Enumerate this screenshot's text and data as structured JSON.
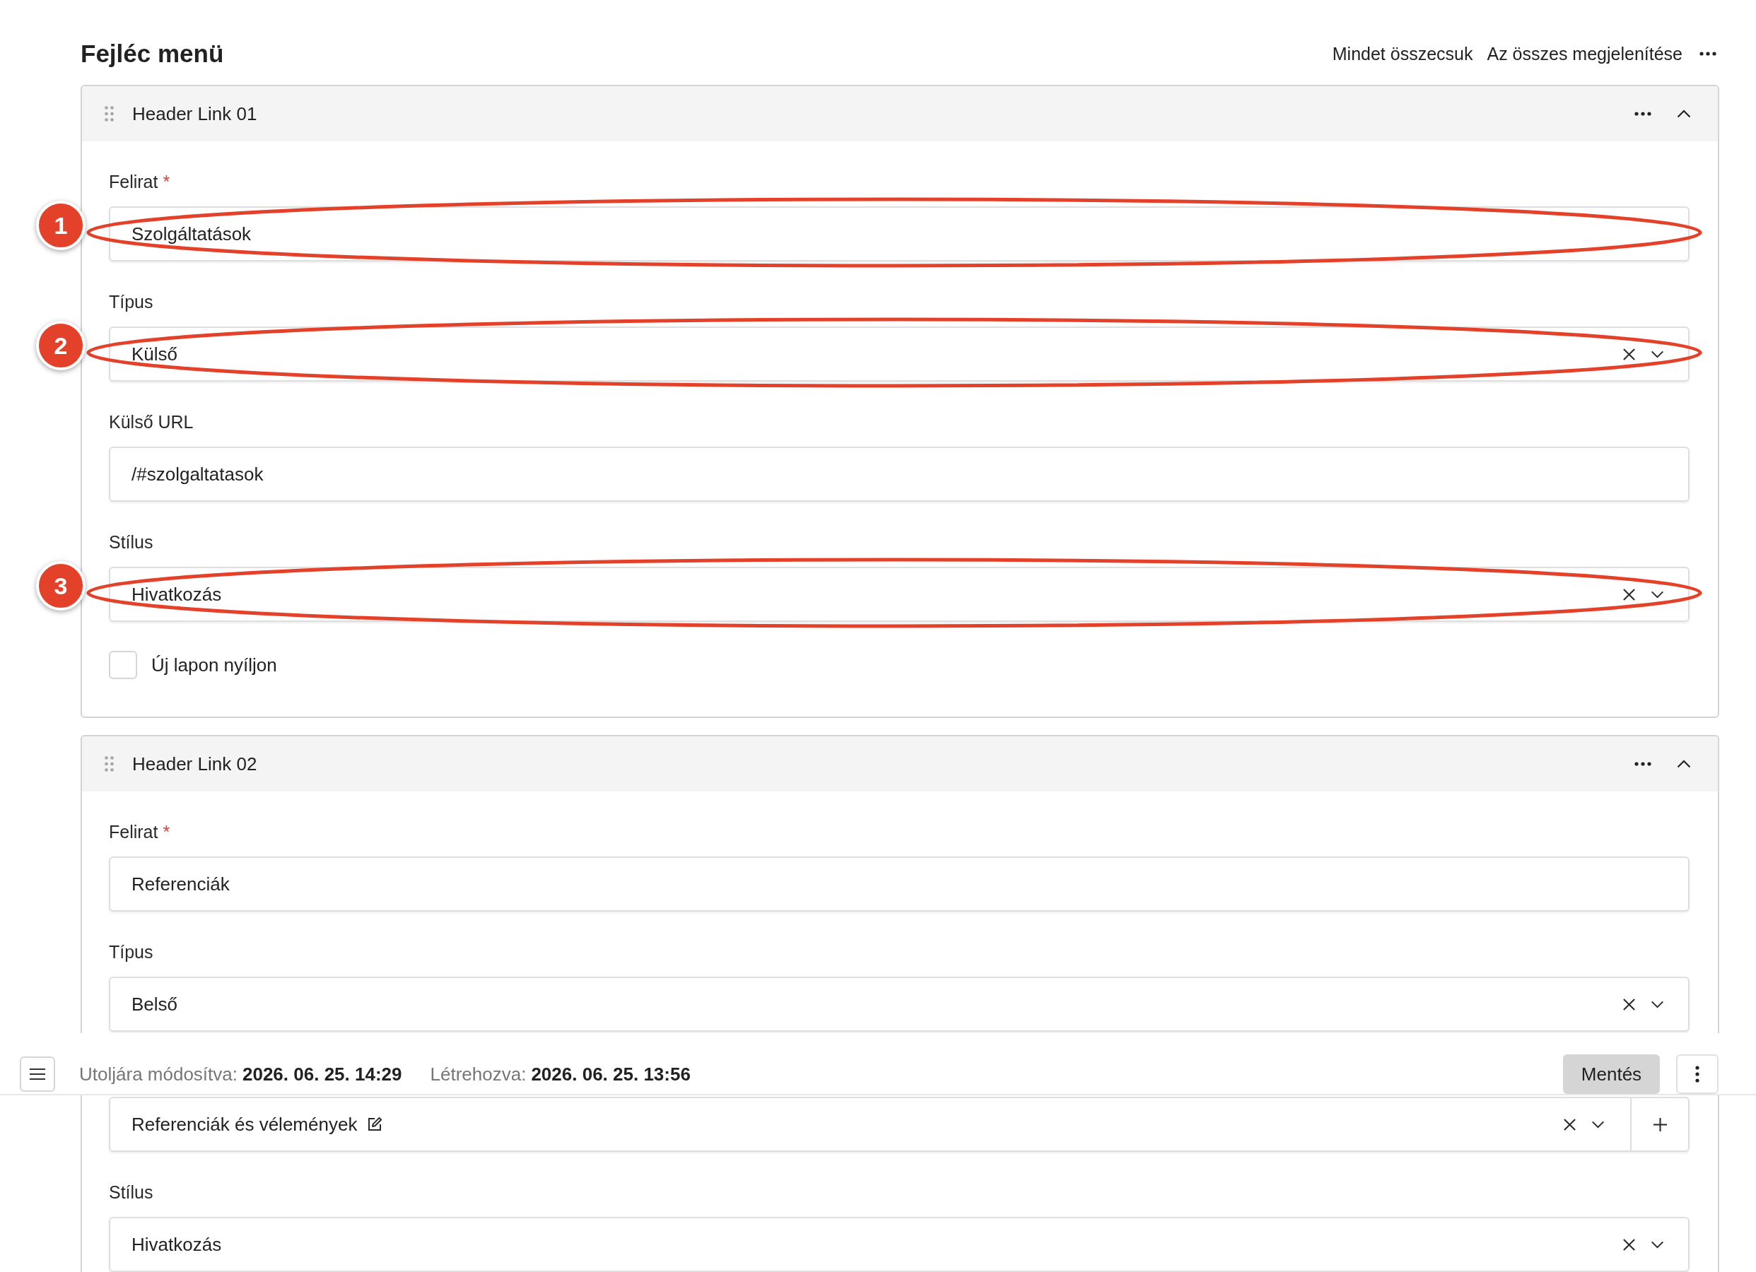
{
  "section": {
    "title": "Fejléc menü",
    "actions": [
      "Mindet összecsuk",
      "Az összes megjelenítése"
    ]
  },
  "items": [
    {
      "title": "Header Link 01",
      "expanded": true,
      "fields": [
        {
          "kind": "text",
          "label": "Felirat",
          "required_mark": "*",
          "value": "Szolgáltatások",
          "annotation": "1"
        },
        {
          "kind": "select",
          "label": "Típus",
          "value": "Külső",
          "annotation": "2"
        },
        {
          "kind": "text",
          "label": "Külső URL",
          "value": "/#szolgaltatasok"
        },
        {
          "kind": "select",
          "label": "Stílus",
          "value": "Hivatkozás",
          "annotation": "3"
        },
        {
          "kind": "checkbox",
          "label": "Új lapon nyíljon",
          "checked": false
        }
      ]
    },
    {
      "title": "Header Link 02",
      "expanded": true,
      "fields": [
        {
          "kind": "text",
          "label": "Felirat",
          "required_mark": "*",
          "value": "Referenciák"
        },
        {
          "kind": "select",
          "label": "Típus",
          "value": "Belső"
        },
        {
          "kind": "relation",
          "value": "Referenciák és vélemények"
        },
        {
          "kind": "select",
          "label": "Stílus",
          "value": "Hivatkozás"
        }
      ]
    }
  ],
  "status_bar": {
    "meta": [
      {
        "label": "Utoljára módosítva:",
        "value": "2026. 06. 25. 14:29"
      },
      {
        "label": "Létrehozva:",
        "value": "2026. 06. 25. 13:56"
      }
    ],
    "save_button": "Mentés"
  }
}
